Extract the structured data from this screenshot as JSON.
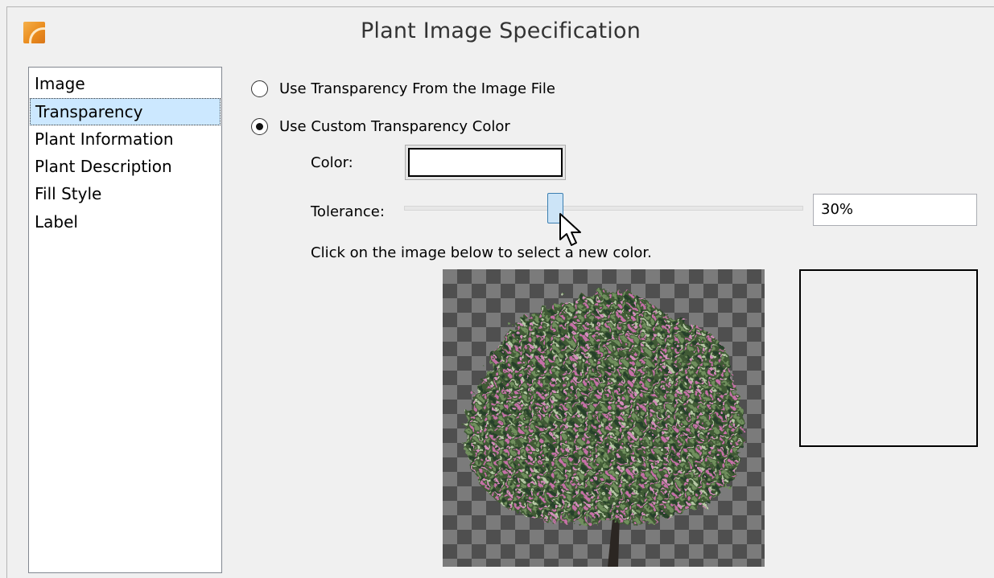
{
  "window": {
    "title": "Plant Image Specification"
  },
  "nav": {
    "items": [
      {
        "label": "Image",
        "selected": false
      },
      {
        "label": "Transparency",
        "selected": true
      },
      {
        "label": "Plant Information",
        "selected": false
      },
      {
        "label": "Plant Description",
        "selected": false
      },
      {
        "label": "Fill Style",
        "selected": false
      },
      {
        "label": "Label",
        "selected": false
      }
    ]
  },
  "transparency": {
    "option_file_label": "Use Transparency From the Image File",
    "option_custom_label": "Use Custom Transparency Color",
    "option_custom_selected": true,
    "color_label": "Color:",
    "color_value": "#ffffff",
    "tolerance_label": "Tolerance:",
    "tolerance_value": "30%",
    "tolerance_fraction": 0.38,
    "instruction": "Click on the image below to select a new color."
  },
  "colors": {
    "accent": "#cce8ff",
    "thumb": "#cce4f7",
    "thumb_border": "#3c7fb1",
    "checker_dark": "#4f4f4f",
    "checker_light": "#7b7b7b",
    "foliage_green": "#3f5a34",
    "blossom_pink": "#c66fa8",
    "trunk": "#2b2622"
  },
  "icons": {
    "app": "chief-architect-logo-icon",
    "cursor": "mouse-pointer-icon"
  }
}
